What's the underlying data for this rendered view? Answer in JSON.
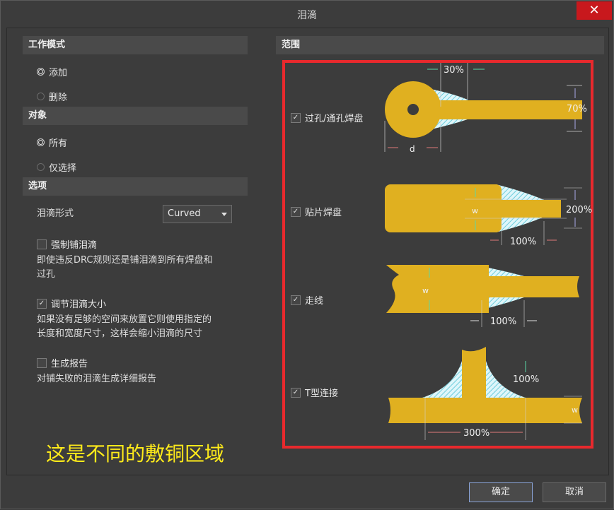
{
  "window": {
    "title": "泪滴",
    "close": "✕"
  },
  "work_mode": {
    "header": "工作模式",
    "options": [
      {
        "label": "添加",
        "selected": true
      },
      {
        "label": "删除",
        "selected": false
      }
    ]
  },
  "object": {
    "header": "对象",
    "options": [
      {
        "label": "所有",
        "selected": true
      },
      {
        "label": "仅选择",
        "selected": false
      }
    ]
  },
  "options": {
    "header": "选项",
    "style_label": "泪滴形式",
    "style_value": "Curved",
    "force_label": "强制铺泪滴",
    "force_checked": false,
    "force_desc_1": "即使违反DRC规则还是铺泪滴到所有焊盘和",
    "force_desc_2": "过孔",
    "adjust_label": "调节泪滴大小",
    "adjust_checked": true,
    "adjust_desc_1": "如果没有足够的空间来放置它则使用指定的",
    "adjust_desc_2": "长度和宽度尺寸，这样会缩小泪滴的尺寸",
    "report_label": "生成报告",
    "report_checked": false,
    "report_desc": "对铺失败的泪滴生成详细报告"
  },
  "scope": {
    "header": "范围",
    "items": [
      {
        "label": "过孔/通孔焊盘",
        "checked": true
      },
      {
        "label": "贴片焊盘",
        "checked": true
      },
      {
        "label": "走线",
        "checked": true
      },
      {
        "label": "T型连接",
        "checked": true
      }
    ],
    "via": {
      "pct_top": "30%",
      "pct_right": "70%",
      "d": "d"
    },
    "smd": {
      "w": "w",
      "pct_right": "200%",
      "pct_bottom": "100%"
    },
    "track": {
      "w": "w",
      "pct_bottom": "100%"
    },
    "tjunction": {
      "pct_mid": "100%",
      "w": "w",
      "pct_bottom": "300%"
    }
  },
  "annotation": "这是不同的敷铜区域",
  "buttons": {
    "ok": "确定",
    "cancel": "取消"
  },
  "colors": {
    "copper": "#e0b020",
    "teardrop_hatch": "#5ad0e0",
    "red_box": "#e8292d",
    "annotation": "#ffeb1a"
  }
}
